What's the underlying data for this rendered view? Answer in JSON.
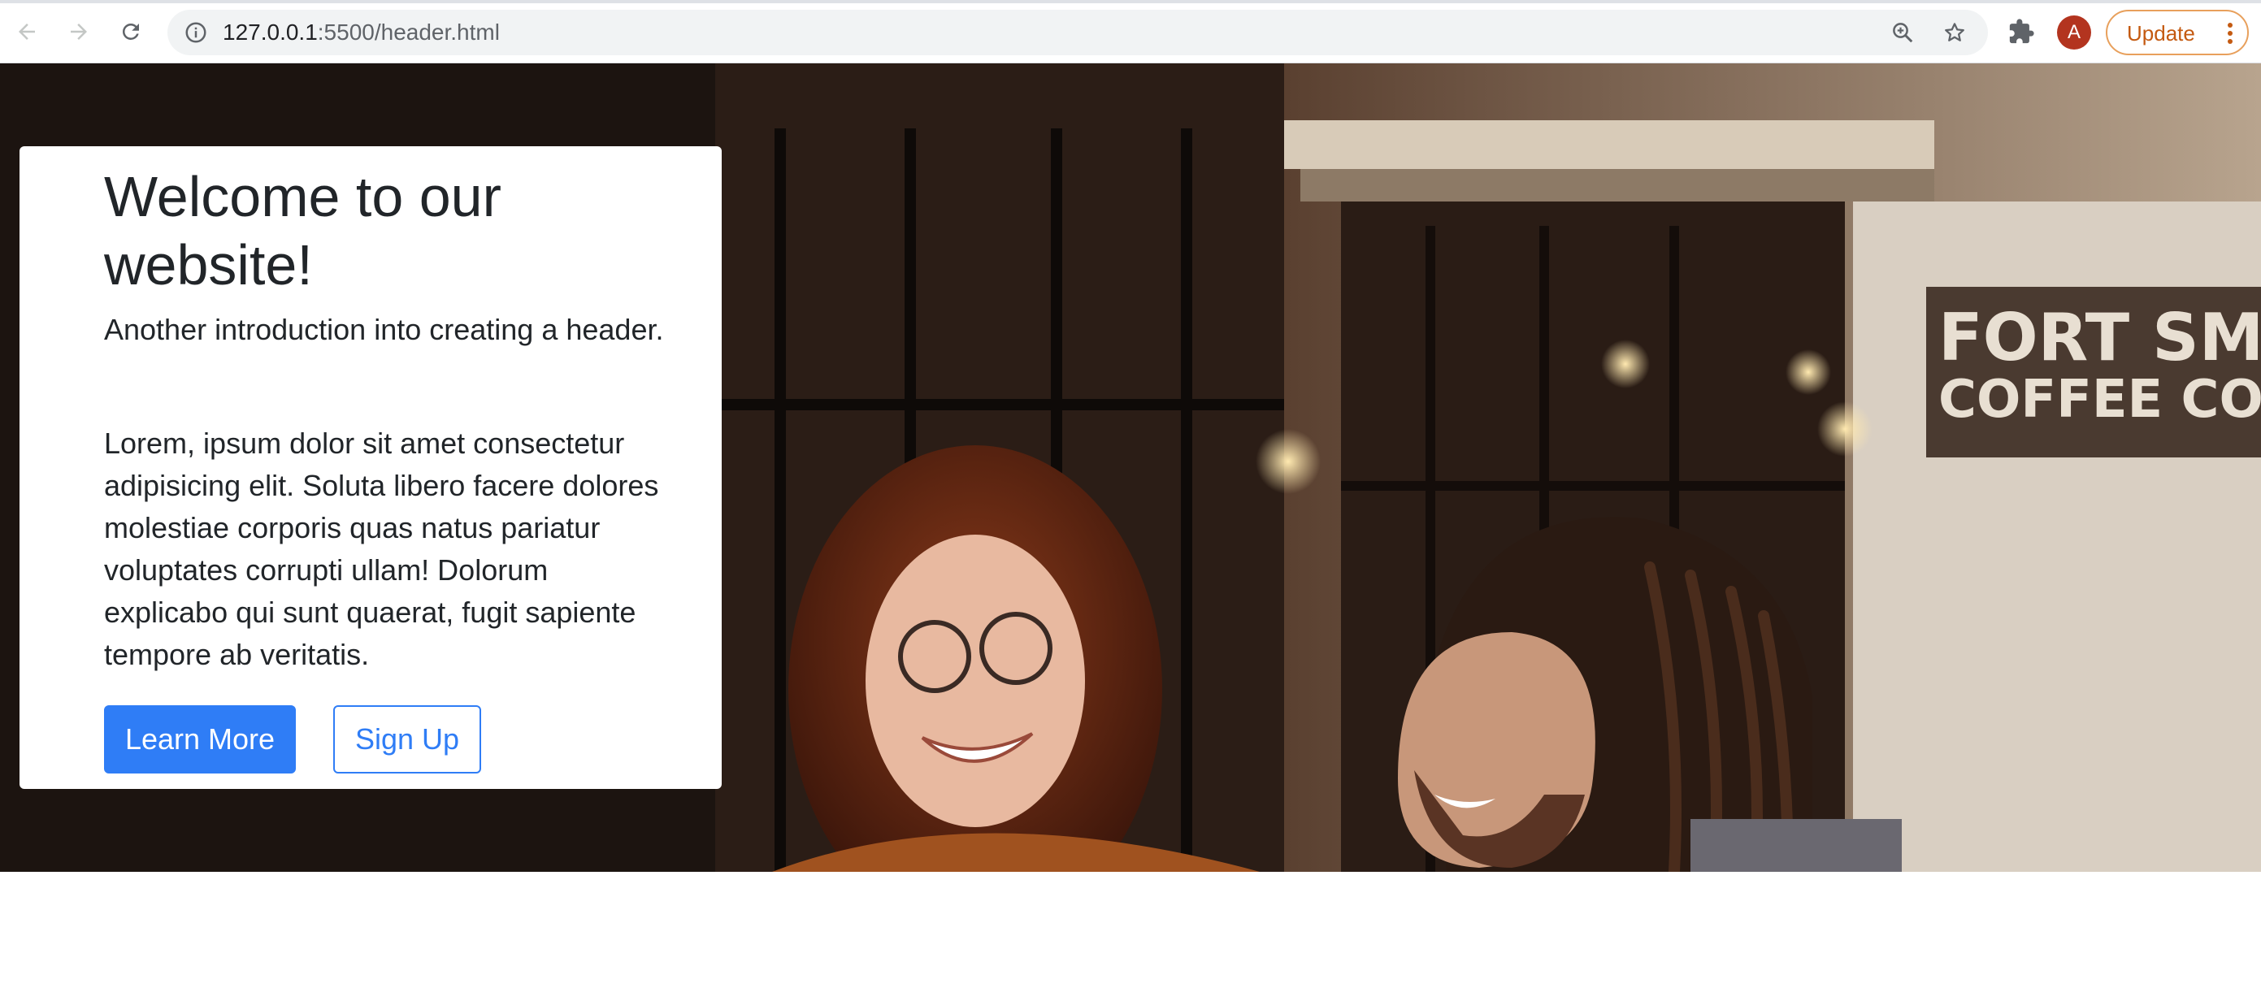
{
  "browser": {
    "url_host": "127.0.0.1",
    "url_rest": ":5500/header.html",
    "avatar_letter": "A",
    "update_label": "Update",
    "icons": [
      "back-arrow-icon",
      "forward-arrow-icon",
      "reload-icon",
      "site-info-icon",
      "zoom-icon",
      "bookmark-star-icon",
      "extensions-puzzle-icon",
      "kebab-menu-icon"
    ]
  },
  "hero": {
    "title": "Welcome to our website!",
    "lead": "Another introduction into creating a header.",
    "body": "Lorem, ipsum dolor sit amet consectetur adipisicing elit. Soluta libero facere dolores molestiae corporis quas natus pariatur voluptates corrupti ullam! Dolorum explicabo qui sunt quaerat, fugit sapiente tempore ab veritatis.",
    "primary_button": "Learn More",
    "secondary_button": "Sign Up",
    "background_sign_text": "FORT SMITH COFFEE CO",
    "colors": {
      "primary": "#2f7df6",
      "text": "#212529"
    }
  }
}
